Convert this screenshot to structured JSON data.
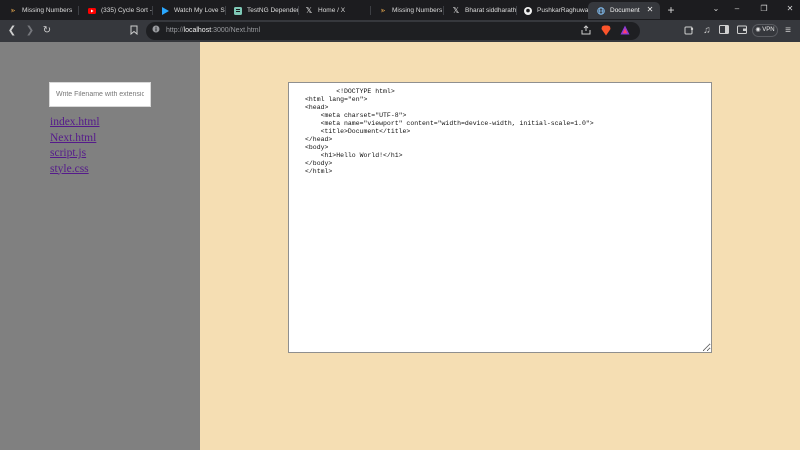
{
  "tabs": [
    {
      "label": "Missing Numbers",
      "icon": "caret-leaf-icon"
    },
    {
      "label": "(335) Cycle Sort -",
      "icon": "youtube-icon"
    },
    {
      "label": "Watch My Love S",
      "icon": "play-icon"
    },
    {
      "label": "TestNG Depender",
      "icon": "document-icon"
    },
    {
      "label": "Home / X",
      "icon": "x-logo-icon"
    },
    {
      "label": "Missing Numbers",
      "icon": "caret-leaf-icon"
    },
    {
      "label": "Bharat siddharath",
      "icon": "x-logo-icon"
    },
    {
      "label": "PushkarRaghuwa",
      "icon": "github-icon"
    },
    {
      "label": "Document",
      "icon": "globe-icon"
    }
  ],
  "address": {
    "scheme": "http://",
    "host": "localhost",
    "rest": ":3000/Next.html"
  },
  "vpn_label": "VPN",
  "sidebar": {
    "input_placeholder": "Write Filename with extension",
    "files": [
      "index.html",
      "Next.html",
      "script.js",
      "style.css"
    ]
  },
  "editor": {
    "content": "        <!DOCTYPE html>\n<html lang=\"en\">\n<head>\n    <meta charset=\"UTF-8\">\n    <meta name=\"viewport\" content=\"width=device-width, initial-scale=1.0\">\n    <title>Document</title>\n</head>\n<body>\n    <h1>Hello World!</h1>\n</body>\n</html>"
  },
  "colors": {
    "sidebar_bg": "#808080",
    "content_bg": "#f5deb3",
    "link_visited": "#551a8b",
    "youtube_red": "#ff0000",
    "brave_orange": "#fb542b"
  }
}
